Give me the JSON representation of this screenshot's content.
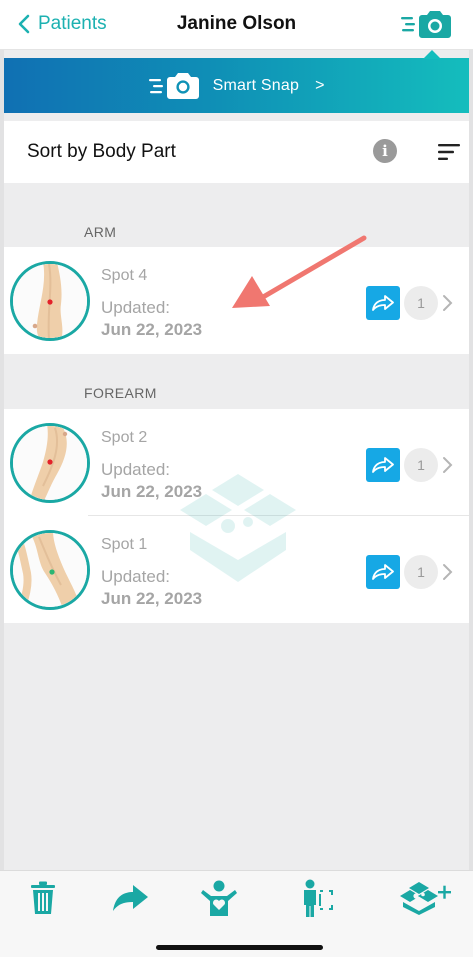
{
  "colors": {
    "accent": "#1aa8a4",
    "share_blue": "#16a8e5",
    "red_dot": "#e3222a",
    "green_dot": "#2bb673"
  },
  "nav": {
    "back_label": "Patients",
    "title": "Janine Olson"
  },
  "banner": {
    "label": "Smart Snap",
    "chevron": ">"
  },
  "sort": {
    "label": "Sort by Body Part",
    "info_glyph": "i"
  },
  "sections": [
    {
      "header": "ARM",
      "spots": [
        {
          "name": "Spot 4",
          "updated_label": "Updated:",
          "date": "Jun 22, 2023",
          "count": "1"
        }
      ]
    },
    {
      "header": "FOREARM",
      "spots": [
        {
          "name": "Spot 2",
          "updated_label": "Updated:",
          "date": "Jun 22, 2023",
          "count": "1"
        },
        {
          "name": "Spot 1",
          "updated_label": "Updated:",
          "date": "Jun 22, 2023",
          "count": "1"
        }
      ]
    }
  ],
  "toolbar": {
    "icons": [
      "trash-icon",
      "share-icon",
      "person-heart-icon",
      "person-compare-icon",
      "box-add-icon"
    ]
  }
}
